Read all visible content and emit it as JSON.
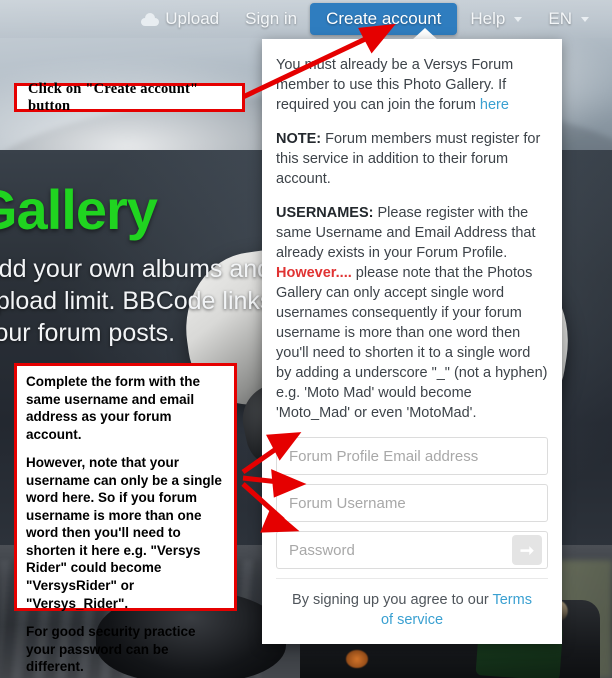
{
  "nav": {
    "items": [
      {
        "label": "Upload",
        "icon": "cloud-upload-icon",
        "active": false,
        "caret": false
      },
      {
        "label": "Sign in",
        "icon": "",
        "active": false,
        "caret": false
      },
      {
        "label": "Create account",
        "icon": "",
        "active": true,
        "caret": false
      },
      {
        "label": "Help",
        "icon": "",
        "active": false,
        "caret": true
      },
      {
        "label": "EN",
        "icon": "",
        "active": false,
        "caret": true
      }
    ],
    "active_bg": "#2f7dbf"
  },
  "hero": {
    "title": "Gallery",
    "subtitle": "Add your own albums and upload limit. BBCode links to your forum posts."
  },
  "panel": {
    "intro_1": "You must already be a Versys Forum member to use this Photo Gallery. If required you can join the forum ",
    "intro_link": "here",
    "note_label": "NOTE:",
    "note_text": " Forum members must register for this service in addition to their forum account.",
    "usernames_label": "USERNAMES:",
    "usernames_part1": " Please register with the same Username and Email Address that already exists in your Forum Profile. ",
    "usernames_warn": "However....",
    "usernames_part2": " please note that the Photos Gallery can only accept single word usernames consequently if your forum username is more than one word then you'll need to shorten it to a single word by adding a underscore \"_\" (not a hyphen) e.g. 'Moto Mad' would become 'Moto_Mad' or even 'MotoMad'.",
    "fields": [
      {
        "name": "email",
        "placeholder": "Forum Profile Email address",
        "value": "",
        "type": "text"
      },
      {
        "name": "username",
        "placeholder": "Forum Username",
        "value": "",
        "type": "text"
      },
      {
        "name": "password",
        "placeholder": "Password",
        "value": "",
        "type": "password"
      }
    ],
    "submit_icon": "arrow-right-icon",
    "footer_text": "By signing up you agree to our ",
    "footer_link": "Terms of service"
  },
  "annotations": {
    "top_box": "Click on \"Create account\" button",
    "main_box": [
      "Complete the form with the same username and email address as your forum account.",
      "However, note that your username can only be a single word here. So if you forum username is more than one word then you'll need to shorten it here e.g. \"Versys Rider\" could become \"VersysRider\" or \"Versys_Rider\".",
      "For good security practice your password can be different."
    ],
    "color": "#e50000"
  }
}
